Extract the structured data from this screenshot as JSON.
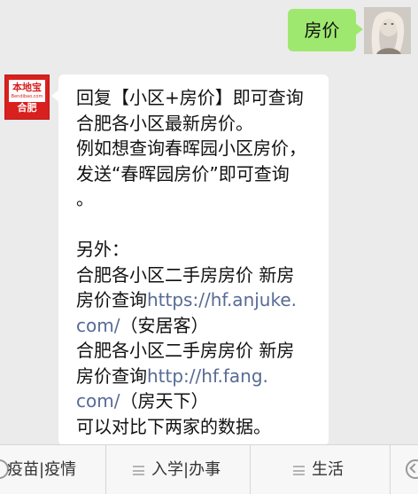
{
  "chat": {
    "sent_message": "房价",
    "received_message": {
      "line1": "回复【小区+房价】即可查询",
      "line2": "合肥各小区最新房价。",
      "line3": "例如想查询春晖园小区房价，",
      "line4": "发送“春晖园房价”即可查询",
      "line5": "。",
      "line6": "另外：",
      "line7": "合肥各小区二手房房价 新房",
      "line8_prefix": "房价查询",
      "link1_part1": "https://hf.anjuke.",
      "link1_part2": "com/",
      "link1_suffix": "（安居客）",
      "line10": "合肥各小区二手房房价 新房",
      "line11_prefix": "房价查询",
      "link2_part1": "http://hf.fang.",
      "link2_part2": "com/",
      "link2_suffix": "（房天下）",
      "line13": "可以对比下两家的数据。"
    }
  },
  "sender": {
    "avatar_icon": "user-avatar-photo"
  },
  "account": {
    "logo_brand": "本地宝",
    "logo_sub": "Bendibao.com",
    "logo_city": "合肥",
    "brand_color": "#d8201f"
  },
  "menu": {
    "items": [
      {
        "label": "疫苗|疫情"
      },
      {
        "label": "入学|办事"
      },
      {
        "label": "生活"
      }
    ]
  },
  "colors": {
    "sent_bubble": "#9ee86f",
    "received_bubble": "#ffffff",
    "link": "#576b95",
    "background": "#ebebeb"
  }
}
